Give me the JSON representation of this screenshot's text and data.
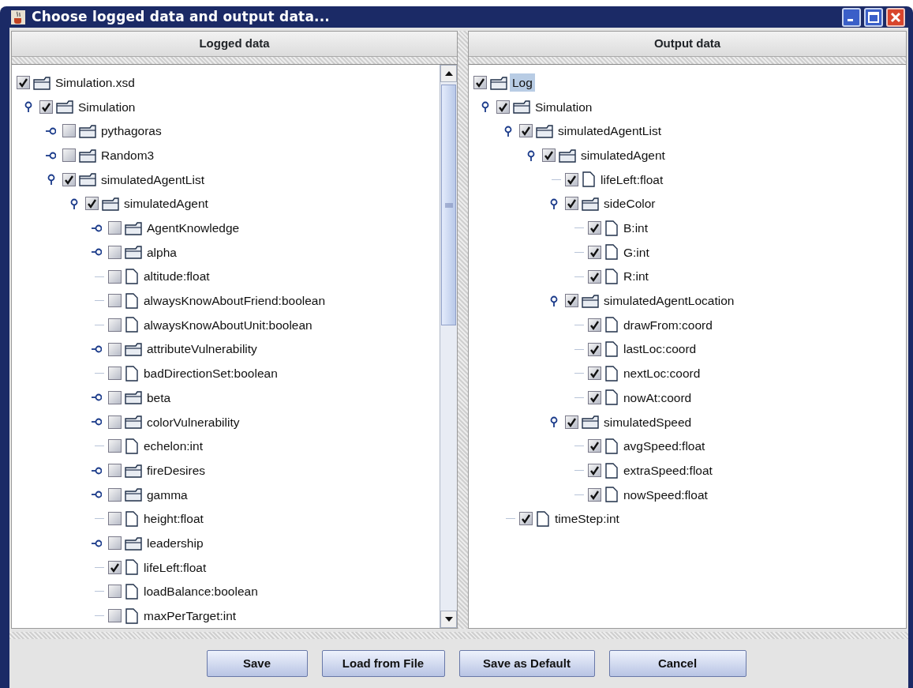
{
  "window": {
    "title": "Choose logged data and output data..."
  },
  "logged_data": {
    "header": "Logged data",
    "tree": [
      {
        "label": "Simulation.xsd",
        "kind": "folder",
        "checked": true,
        "selected": false,
        "children": [
          {
            "label": "Simulation",
            "kind": "folder",
            "checked": true,
            "selected": false,
            "expanded": true,
            "children": [
              {
                "label": "pythagoras",
                "kind": "folder",
                "checked": false,
                "selected": false,
                "expanded": false
              },
              {
                "label": "Random3",
                "kind": "folder",
                "checked": false,
                "selected": false,
                "expanded": false
              },
              {
                "label": "simulatedAgentList",
                "kind": "folder",
                "checked": true,
                "selected": false,
                "expanded": true,
                "children": [
                  {
                    "label": "simulatedAgent",
                    "kind": "folder",
                    "checked": true,
                    "selected": false,
                    "expanded": true,
                    "children": [
                      {
                        "label": "AgentKnowledge",
                        "kind": "folder",
                        "checked": false,
                        "selected": false,
                        "expanded": false
                      },
                      {
                        "label": "alpha",
                        "kind": "folder",
                        "checked": false,
                        "selected": false,
                        "expanded": false
                      },
                      {
                        "label": "altitude:float",
                        "kind": "file",
                        "checked": false,
                        "selected": false
                      },
                      {
                        "label": "alwaysKnowAboutFriend:boolean",
                        "kind": "file",
                        "checked": false,
                        "selected": false
                      },
                      {
                        "label": "alwaysKnowAboutUnit:boolean",
                        "kind": "file",
                        "checked": false,
                        "selected": false
                      },
                      {
                        "label": "attributeVulnerability",
                        "kind": "folder",
                        "checked": false,
                        "selected": false,
                        "expanded": false
                      },
                      {
                        "label": "badDirectionSet:boolean",
                        "kind": "file",
                        "checked": false,
                        "selected": false
                      },
                      {
                        "label": "beta",
                        "kind": "folder",
                        "checked": false,
                        "selected": false,
                        "expanded": false
                      },
                      {
                        "label": "colorVulnerability",
                        "kind": "folder",
                        "checked": false,
                        "selected": false,
                        "expanded": false
                      },
                      {
                        "label": "echelon:int",
                        "kind": "file",
                        "checked": false,
                        "selected": false
                      },
                      {
                        "label": "fireDesires",
                        "kind": "folder",
                        "checked": false,
                        "selected": false,
                        "expanded": false
                      },
                      {
                        "label": "gamma",
                        "kind": "folder",
                        "checked": false,
                        "selected": false,
                        "expanded": false
                      },
                      {
                        "label": "height:float",
                        "kind": "file",
                        "checked": false,
                        "selected": false
                      },
                      {
                        "label": "leadership",
                        "kind": "folder",
                        "checked": false,
                        "selected": false,
                        "expanded": false
                      },
                      {
                        "label": "lifeLeft:float",
                        "kind": "file",
                        "checked": true,
                        "selected": false
                      },
                      {
                        "label": "loadBalance:boolean",
                        "kind": "file",
                        "checked": false,
                        "selected": false
                      },
                      {
                        "label": "maxPerTarget:int",
                        "kind": "file",
                        "checked": false,
                        "selected": false
                      }
                    ]
                  }
                ]
              }
            ]
          }
        ]
      }
    ]
  },
  "output_data": {
    "header": "Output data",
    "tree": [
      {
        "label": "Log",
        "kind": "folder",
        "checked": true,
        "selected": true,
        "children": [
          {
            "label": "Simulation",
            "kind": "folder",
            "checked": true,
            "selected": false,
            "expanded": true,
            "children": [
              {
                "label": "simulatedAgentList",
                "kind": "folder",
                "checked": true,
                "selected": false,
                "expanded": true,
                "children": [
                  {
                    "label": "simulatedAgent",
                    "kind": "folder",
                    "checked": true,
                    "selected": false,
                    "expanded": true,
                    "children": [
                      {
                        "label": "lifeLeft:float",
                        "kind": "file",
                        "checked": true,
                        "selected": false
                      },
                      {
                        "label": "sideColor",
                        "kind": "folder",
                        "checked": true,
                        "selected": false,
                        "expanded": true,
                        "children": [
                          {
                            "label": "B:int",
                            "kind": "file",
                            "checked": true,
                            "selected": false
                          },
                          {
                            "label": "G:int",
                            "kind": "file",
                            "checked": true,
                            "selected": false
                          },
                          {
                            "label": "R:int",
                            "kind": "file",
                            "checked": true,
                            "selected": false
                          }
                        ]
                      },
                      {
                        "label": "simulatedAgentLocation",
                        "kind": "folder",
                        "checked": true,
                        "selected": false,
                        "expanded": true,
                        "children": [
                          {
                            "label": "drawFrom:coord",
                            "kind": "file",
                            "checked": true,
                            "selected": false
                          },
                          {
                            "label": "lastLoc:coord",
                            "kind": "file",
                            "checked": true,
                            "selected": false
                          },
                          {
                            "label": "nextLoc:coord",
                            "kind": "file",
                            "checked": true,
                            "selected": false
                          },
                          {
                            "label": "nowAt:coord",
                            "kind": "file",
                            "checked": true,
                            "selected": false
                          }
                        ]
                      },
                      {
                        "label": "simulatedSpeed",
                        "kind": "folder",
                        "checked": true,
                        "selected": false,
                        "expanded": true,
                        "children": [
                          {
                            "label": "avgSpeed:float",
                            "kind": "file",
                            "checked": true,
                            "selected": false
                          },
                          {
                            "label": "extraSpeed:float",
                            "kind": "file",
                            "checked": true,
                            "selected": false
                          },
                          {
                            "label": "nowSpeed:float",
                            "kind": "file",
                            "checked": true,
                            "selected": false
                          }
                        ]
                      }
                    ]
                  }
                ]
              },
              {
                "label": "timeStep:int",
                "kind": "file",
                "checked": true,
                "selected": false
              }
            ]
          }
        ]
      }
    ]
  },
  "buttons": [
    "Save",
    "Load from File",
    "Save as Default",
    "Cancel"
  ]
}
